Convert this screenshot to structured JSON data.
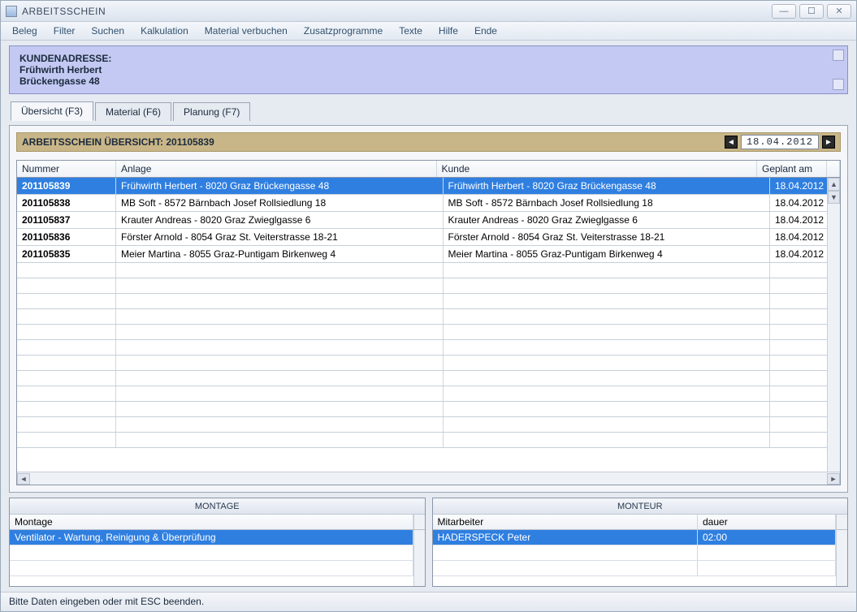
{
  "window": {
    "title": "ARBEITSSCHEIN"
  },
  "menu": {
    "items": [
      "Beleg",
      "Filter",
      "Suchen",
      "Kalkulation",
      "Material verbuchen",
      "Zusatzprogramme",
      "Texte",
      "Hilfe",
      "Ende"
    ]
  },
  "address": {
    "heading": "KUNDENADRESSE:",
    "line1": "Frühwirth Herbert",
    "line2": "Brückengasse 48"
  },
  "tabs": {
    "items": [
      {
        "label": "Übersicht (F3)",
        "active": true
      },
      {
        "label": "Material (F6)",
        "active": false
      },
      {
        "label": "Planung (F7)",
        "active": false
      }
    ]
  },
  "overview": {
    "title": "ARBEITSSCHEIN ÜBERSICHT: 201105839",
    "date": "18.04.2012",
    "columns": {
      "nummer": "Nummer",
      "anlage": "Anlage",
      "kunde": "Kunde",
      "geplant": "Geplant am"
    },
    "rows": [
      {
        "nummer": "201105839",
        "anlage": "Frühwirth Herbert - 8020 Graz Brückengasse 48",
        "kunde": "Frühwirth Herbert - 8020 Graz Brückengasse 48",
        "geplant": "18.04.2012",
        "selected": true
      },
      {
        "nummer": "201105838",
        "anlage": "MB Soft - 8572 Bärnbach Josef Rollsiedlung 18",
        "kunde": "MB Soft - 8572 Bärnbach Josef Rollsiedlung 18",
        "geplant": "18.04.2012",
        "selected": false
      },
      {
        "nummer": "201105837",
        "anlage": "Krauter Andreas - 8020 Graz Zwieglgasse 6",
        "kunde": "Krauter Andreas - 8020 Graz Zwieglgasse 6",
        "geplant": "18.04.2012",
        "selected": false
      },
      {
        "nummer": "201105836",
        "anlage": "Förster Arnold - 8054 Graz St. Veiterstrasse 18-21",
        "kunde": "Förster Arnold - 8054 Graz St. Veiterstrasse 18-21",
        "geplant": "18.04.2012",
        "selected": false
      },
      {
        "nummer": "201105835",
        "anlage": "Meier Martina - 8055 Graz-Puntigam Birkenweg 4",
        "kunde": "Meier Martina - 8055 Graz-Puntigam Birkenweg 4",
        "geplant": "18.04.2012",
        "selected": false
      }
    ],
    "empty_rows": 12
  },
  "montage": {
    "caption": "MONTAGE",
    "header": "Montage",
    "rows": [
      {
        "text": "Ventilator - Wartung, Reinigung & Überprüfung",
        "selected": true
      }
    ],
    "empty_rows": 2
  },
  "monteur": {
    "caption": "MONTEUR",
    "headers": {
      "mitarbeiter": "Mitarbeiter",
      "dauer": "dauer"
    },
    "rows": [
      {
        "mitarbeiter": "HADERSPECK Peter",
        "dauer": "02:00",
        "selected": true
      }
    ],
    "empty_rows": 2
  },
  "status": "Bitte Daten eingeben oder mit ESC beenden."
}
